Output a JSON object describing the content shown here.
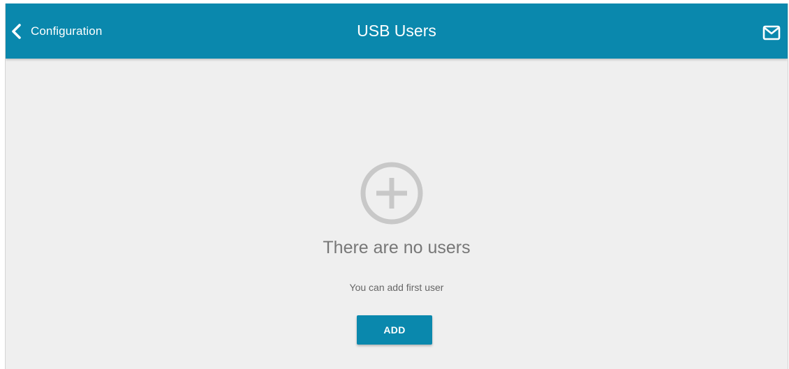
{
  "header": {
    "back_label": "Configuration",
    "title": "USB Users",
    "back_icon": "chevron-left-icon",
    "mail_icon": "envelope-icon",
    "background": "#0a88ad"
  },
  "empty_state": {
    "icon": "plus-circle-icon",
    "title": "There are no users",
    "subtitle": "You can add first user",
    "add_label": "ADD"
  },
  "colors": {
    "accent": "#0a88ad",
    "page_bg": "#efefef",
    "muted_text": "#777777",
    "icon_gray": "#c8c8c8"
  }
}
